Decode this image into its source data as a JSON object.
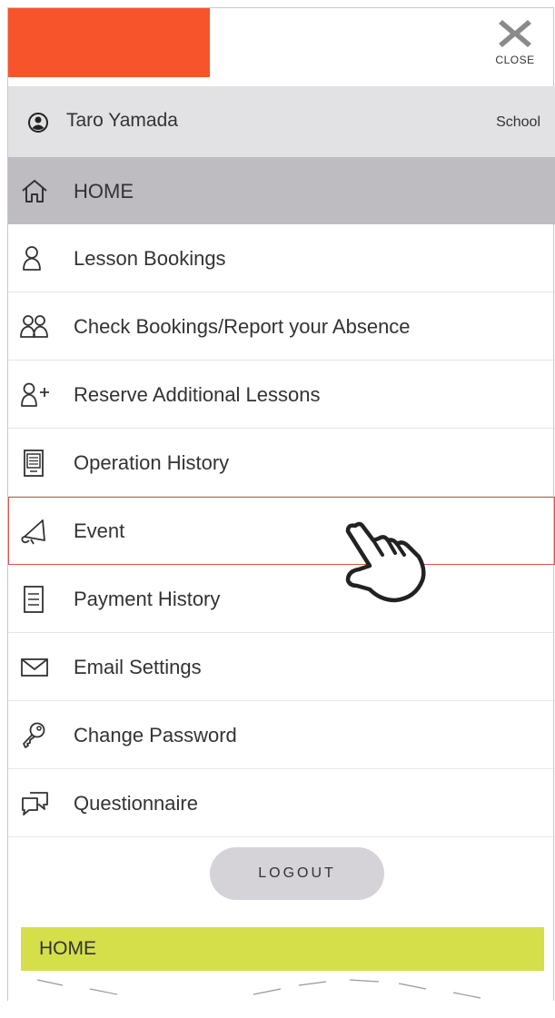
{
  "header": {
    "brand_color": "#f7542c",
    "close_label": "CLOSE"
  },
  "user": {
    "name": "Taro Yamada",
    "role": "School"
  },
  "menu": [
    {
      "label": "HOME",
      "icon": "home-icon"
    },
    {
      "label": "Lesson Bookings",
      "icon": "person-icon"
    },
    {
      "label": "Check Bookings/Report your Absence",
      "icon": "people-icon"
    },
    {
      "label": "Reserve Additional Lessons",
      "icon": "person-add-icon"
    },
    {
      "label": "Operation History",
      "icon": "tablet-icon"
    },
    {
      "label": "Event",
      "icon": "megaphone-icon"
    },
    {
      "label": "Payment History",
      "icon": "document-icon"
    },
    {
      "label": "Email Settings",
      "icon": "mail-icon"
    },
    {
      "label": "Change Password",
      "icon": "key-icon"
    },
    {
      "label": "Questionnaire",
      "icon": "chat-icon"
    }
  ],
  "logout_label": "LOGOUT",
  "page_header": "HOME",
  "colors": {
    "home_highlight": "#bebcc0",
    "user_row_bg": "#e2e2e4",
    "page_header_bg": "#d4df4a",
    "event_outline": "#d9534f"
  }
}
